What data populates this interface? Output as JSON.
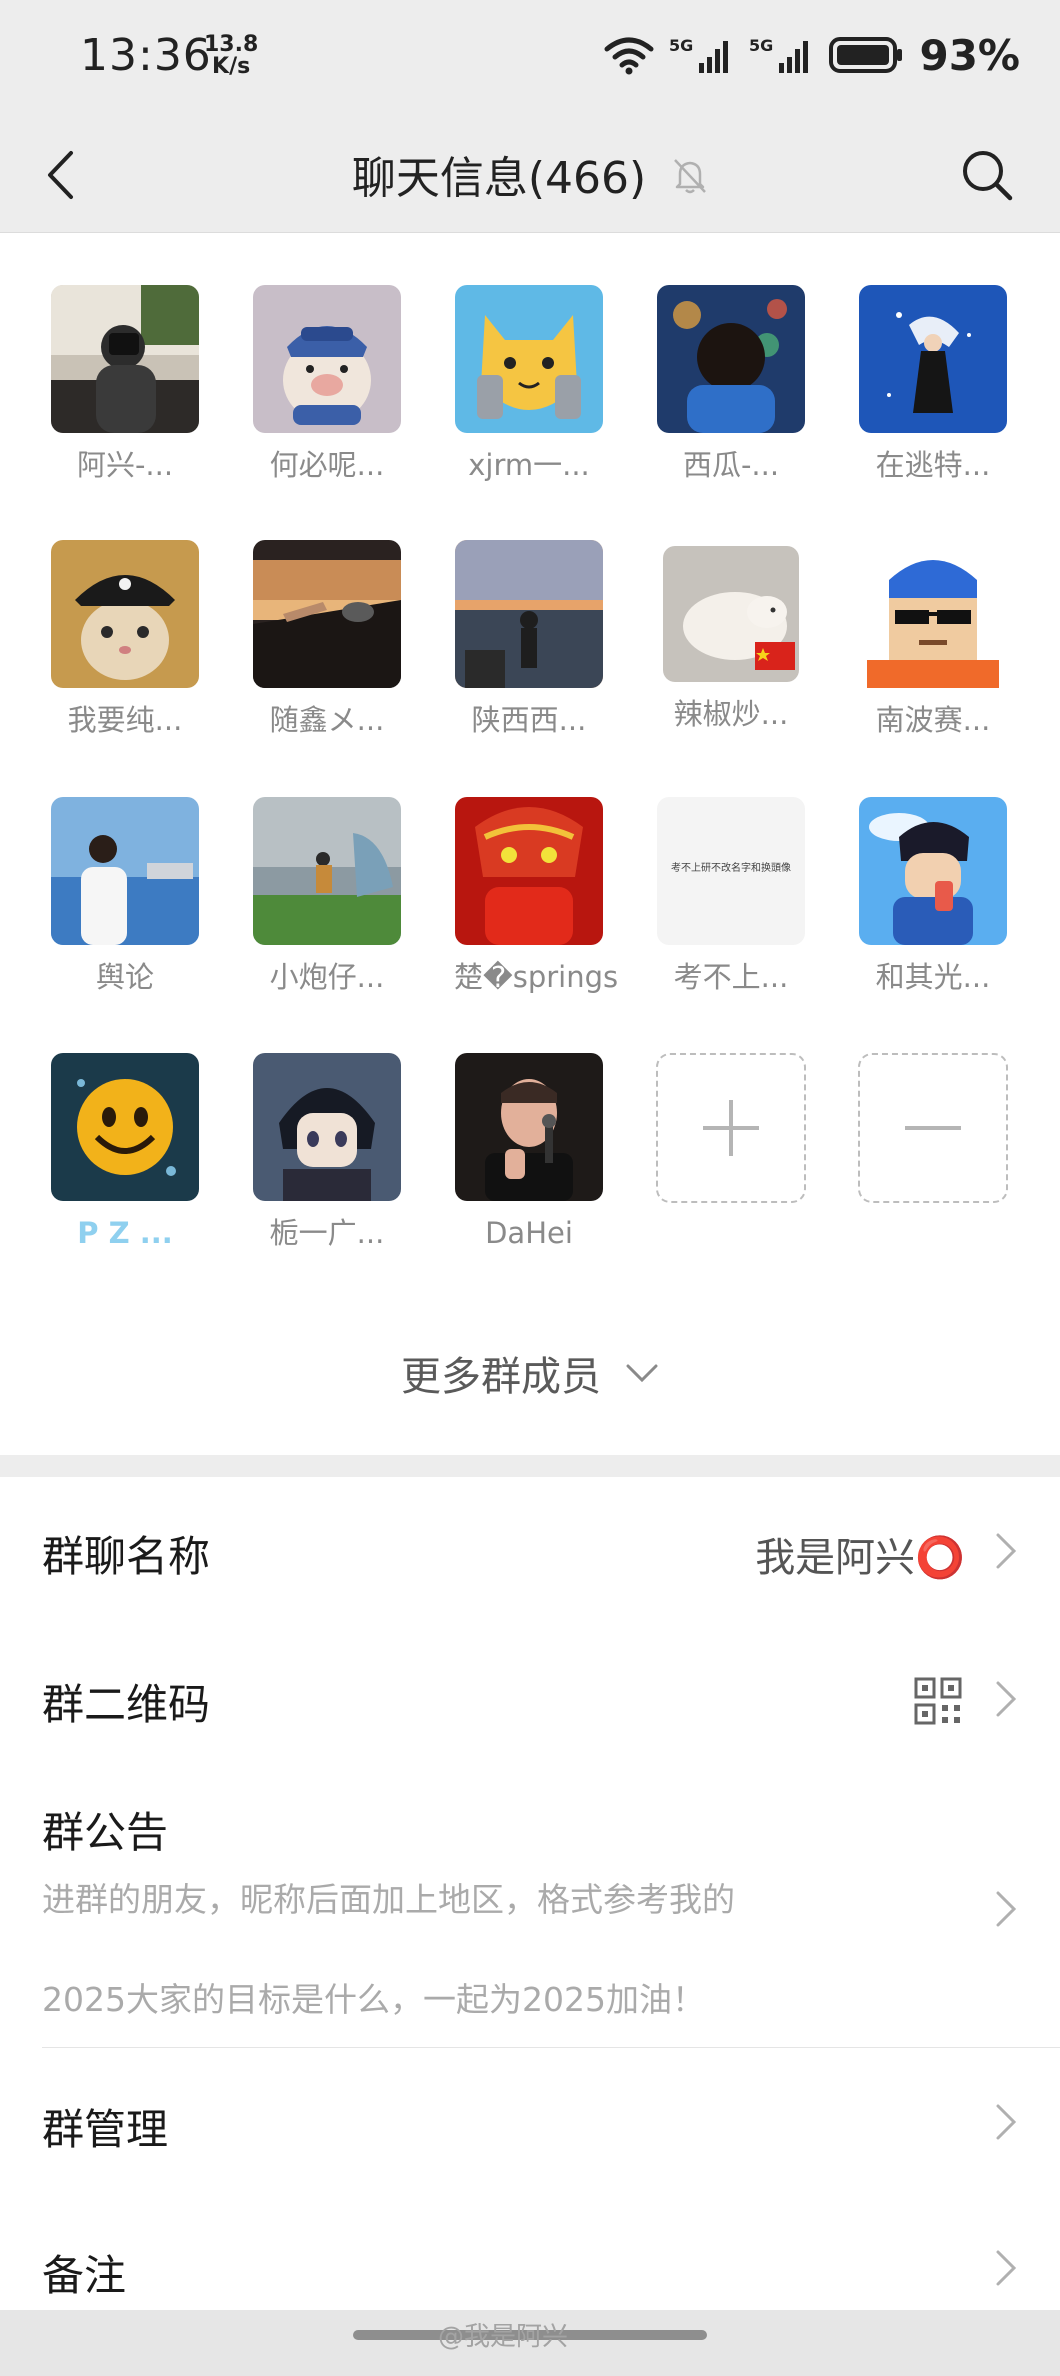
{
  "status_bar": {
    "time": "13:36",
    "speed_value": "13.8",
    "speed_unit": "K/s",
    "battery": "93%"
  },
  "nav": {
    "title": "聊天信息(466)"
  },
  "members": [
    {
      "name": "阿兴-..."
    },
    {
      "name": "何必呢..."
    },
    {
      "name": "xjrm一..."
    },
    {
      "name": "西瓜-..."
    },
    {
      "name": "在逃特..."
    },
    {
      "name": "我要纯..."
    },
    {
      "name": "随鑫メ..."
    },
    {
      "name": "陕西西..."
    },
    {
      "name": "辣椒炒..."
    },
    {
      "name": "南波赛..."
    },
    {
      "name": "舆论"
    },
    {
      "name": "小炮仔..."
    },
    {
      "name": "楚�springs"
    },
    {
      "name": "考不上..."
    },
    {
      "name": "和其光..."
    },
    {
      "name": "P Z ..."
    },
    {
      "name": "栀一广..."
    },
    {
      "name": "DaHei"
    }
  ],
  "avatar_text": {
    "kaobushang": "考不上研不改名字和换頭像"
  },
  "more_members": "更多群成员",
  "settings": {
    "group_name_label": "群聊名称",
    "group_name_value": "我是阿兴⭕",
    "qr_label": "群二维码",
    "notice_label": "群公告",
    "notice_line1": "进群的朋友，昵称后面加上地区，格式参考我的",
    "notice_line2": "2025大家的目标是什么，一起为2025加油！",
    "manage_label": "群管理",
    "remark_label": "备注"
  },
  "watermark": "@我是阿兴",
  "colors": {
    "bar_bg": "#ededed",
    "text_primary": "#1a1a1a",
    "text_secondary": "#8a8a8a"
  }
}
